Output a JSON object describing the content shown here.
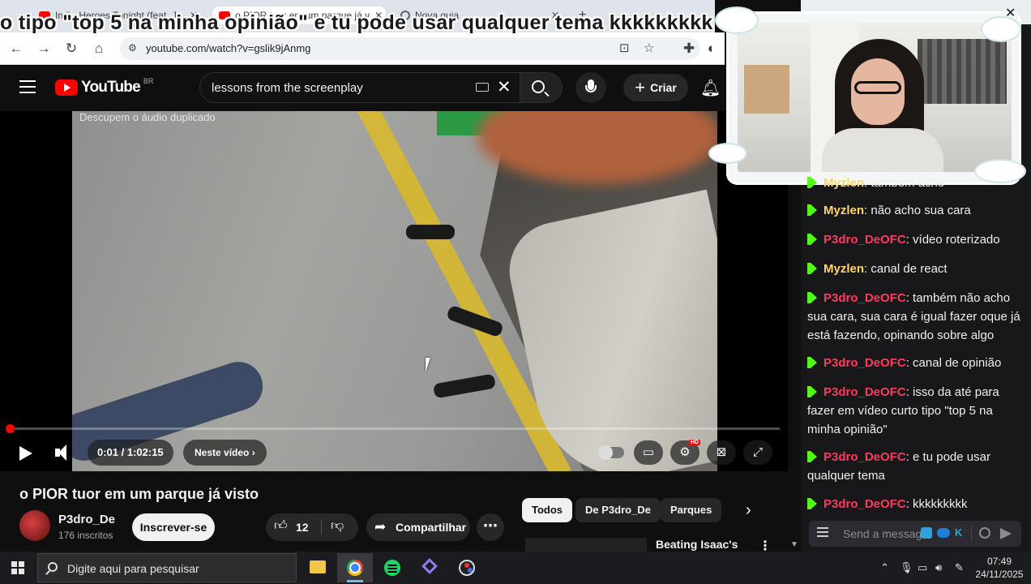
{
  "browser": {
    "tabs": [
      {
        "title": "Imii - Heroes Tonight (feat. J...",
        "favicon": "youtube-icon",
        "active": false
      },
      {
        "title": "o PIOR tuor em um parque já v",
        "favicon": "youtube-icon",
        "active": true
      },
      {
        "title": "Nova guia",
        "favicon": "globe-icon",
        "active": false
      }
    ],
    "url": "youtube.com/watch?v=gslik9jAnmg"
  },
  "stream_overlay_text": "o tipo \"top 5 na minha opinião\" e tu pode usar qualquer tema kkkkkkkkk",
  "youtube": {
    "logo_text": "YouTube",
    "country_code": "BR",
    "search_query": "lessons from the screenplay",
    "create_label": "Criar",
    "video": {
      "caption": "Descupem o áudio duplicado",
      "time": "0:01 / 1:02:15",
      "chapter_label": "Neste vídeo",
      "chapter_chevron": "›",
      "hd_badge": "HD",
      "progress": 0.0003,
      "title": "o PIOR tuor em um parque já visto"
    },
    "channel": {
      "name": "P3dro_De",
      "subscribers": "176 inscritos"
    },
    "subscribe_label": "Inscrever-se",
    "likes": "12",
    "share_label": "Compartilhar",
    "chips": [
      "Todos",
      "De P3dro_De",
      "Parques"
    ],
    "recommendation": {
      "title": "Beating Isaac's"
    }
  },
  "chat": {
    "messages": [
      {
        "user": "Myzlen",
        "text": ": também acho",
        "color": "#ffd66b"
      },
      {
        "user": "Myzlen",
        "text": ": não acho sua cara",
        "color": "#ffd66b"
      },
      {
        "user": "P3dro_DeOFC",
        "text": ": vídeo roterizado",
        "color": "#ff3b5c"
      },
      {
        "user": "Myzlen",
        "text": ": canal de react",
        "color": "#ffd66b"
      },
      {
        "user": "P3dro_DeOFC",
        "text": ": também não acho sua cara, sua cara é igual fazer oque já está fazendo, opinando sobre algo",
        "color": "#ff3b5c"
      },
      {
        "user": "P3dro_DeOFC",
        "text": ": canal de opinião",
        "color": "#ff3b5c"
      },
      {
        "user": "P3dro_DeOFC",
        "text": ": isso da até para fazer em vídeo curto tipo \"top 5 na minha opinião\"",
        "color": "#ff3b5c"
      },
      {
        "user": "P3dro_DeOFC",
        "text": ": e tu pode usar qualquer tema",
        "color": "#ff3b5c"
      },
      {
        "user": "P3dro_DeOFC",
        "text": ": kkkkkkkkk",
        "color": "#ff3b5c"
      }
    ],
    "input_placeholder": "Send a message"
  },
  "taskbar": {
    "search_placeholder": "Digite aqui para pesquisar",
    "time": "07:49",
    "date": "24/11/2025"
  }
}
